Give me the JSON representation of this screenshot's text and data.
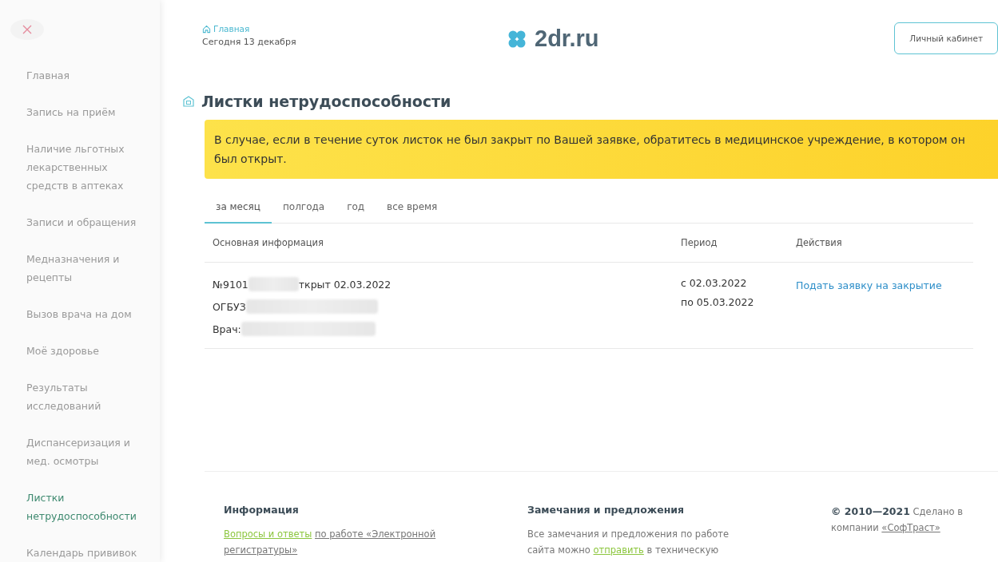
{
  "sidebar": {
    "items": [
      {
        "label": "Главная",
        "selected": false
      },
      {
        "label": "Запись на приём",
        "selected": false
      },
      {
        "label": "Наличие льготных лекарственных средств в аптеках",
        "selected": false
      },
      {
        "label": "Записи и обращения",
        "selected": false
      },
      {
        "label": "Медназначения и рецепты",
        "selected": false
      },
      {
        "label": "Вызов врача на дом",
        "selected": false
      },
      {
        "label": "Моё здоровье",
        "selected": false
      },
      {
        "label": "Результаты исследований",
        "selected": false
      },
      {
        "label": "Диспансеризация и мед. осмотры",
        "selected": false
      },
      {
        "label": "Листки нетрудоспособности",
        "selected": true
      },
      {
        "label": "Календарь прививок",
        "selected": false
      }
    ]
  },
  "header": {
    "breadcrumb": "Главная",
    "date": "Сегодня 13 декабря",
    "logo": "2dr.ru",
    "account_button": "Личный кабинет"
  },
  "page": {
    "title": "Листки нетрудоспособности",
    "notice": "В случае, если в течение суток листок не был закрыт по Вашей заявке, обратитесь в медицинское учреждение, в котором он был открыт.",
    "tabs": [
      {
        "label": "за месяц",
        "selected": true
      },
      {
        "label": "полгода",
        "selected": false
      },
      {
        "label": "год",
        "selected": false
      },
      {
        "label": "все время",
        "selected": false
      }
    ],
    "table": {
      "columns": [
        "Основная информация",
        "Период",
        "Действия"
      ],
      "rows": [
        {
          "number": "№9101",
          "opened": "ткрыт 02.03.2022",
          "org": "ОГБУЗ",
          "doctor": "Врач:",
          "period_from": "с 02.03.2022",
          "period_to": "по 05.03.2022",
          "action": "Подать заявку на закрытие"
        }
      ]
    }
  },
  "footer": {
    "info": {
      "title": "Информация",
      "link": "Вопросы и ответы",
      "text": "по работе «Электронной регистратуры»"
    },
    "feedback": {
      "title": "Замечания и предложения",
      "before": "Все замечания и предложения по работе сайта можно",
      "link": "отправить",
      "after": "в техническую"
    },
    "copyright": {
      "years": "© 2010—2021",
      "text": "Сделано в компании",
      "link": "«СофТраст»"
    }
  }
}
